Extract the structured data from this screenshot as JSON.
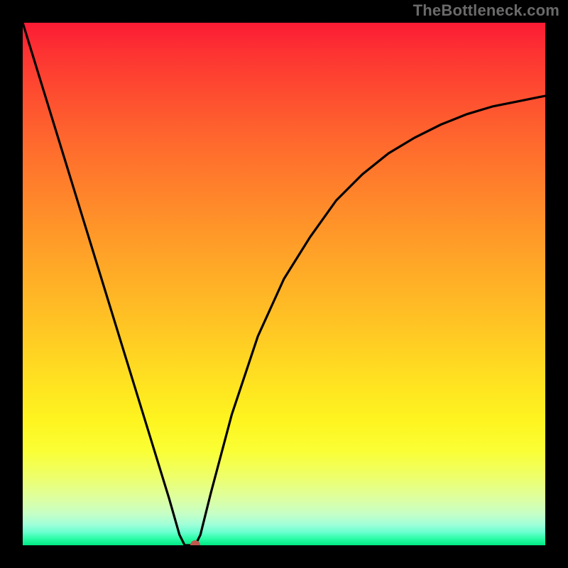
{
  "watermark": "TheBottleneck.com",
  "chart_data": {
    "type": "line",
    "title": "",
    "xlabel": "",
    "ylabel": "",
    "xlim": [
      0,
      100
    ],
    "ylim": [
      0,
      100
    ],
    "x": [
      0,
      4,
      8,
      12,
      16,
      20,
      24,
      28,
      30,
      31,
      32,
      33,
      34,
      36,
      40,
      45,
      50,
      55,
      60,
      65,
      70,
      75,
      80,
      85,
      90,
      95,
      100
    ],
    "y": [
      100,
      87,
      74,
      61,
      48,
      35,
      22,
      9,
      2,
      0,
      0,
      0,
      2,
      10,
      25,
      40,
      51,
      59,
      66,
      71,
      75,
      78,
      80.5,
      82.5,
      84,
      85,
      86
    ],
    "marker": {
      "x": 33,
      "y": 0
    },
    "background_gradient": {
      "top_color": "#fc1b35",
      "mid_color": "#ffe021",
      "bottom_color": "#00e983"
    }
  }
}
